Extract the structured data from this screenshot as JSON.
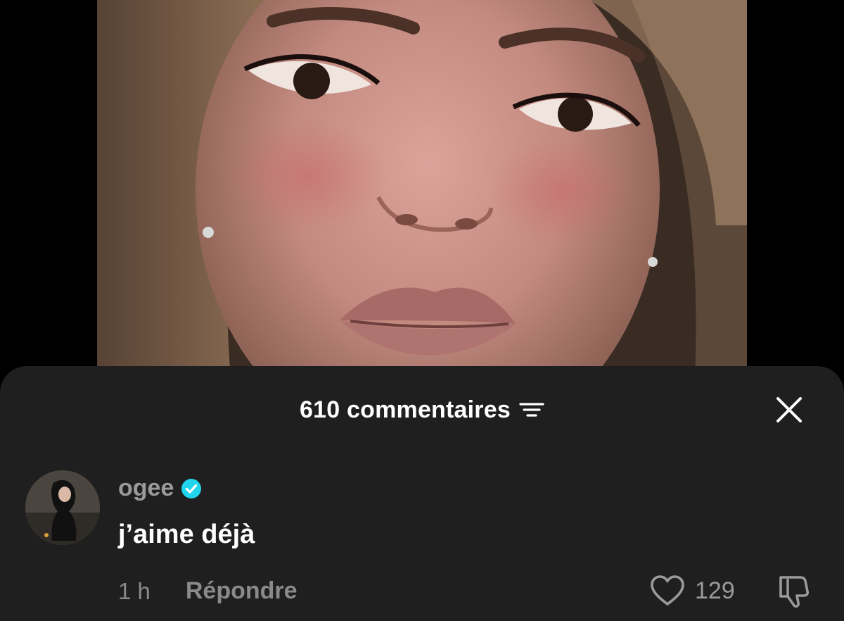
{
  "comments_sheet": {
    "title": "610 commentaires",
    "sort_icon": "sort-lines-icon",
    "close_icon": "close-icon"
  },
  "comment": {
    "username": "ogee",
    "verified": true,
    "verified_color": "#20D5EC",
    "text": "j’aime déjà",
    "timestamp": "1 h",
    "reply_label": "Répondre",
    "like_count": "129"
  },
  "colors": {
    "sheet_background": "#1f1f1f",
    "primary_text": "#ffffff",
    "secondary_text": "#8a8a8a"
  }
}
